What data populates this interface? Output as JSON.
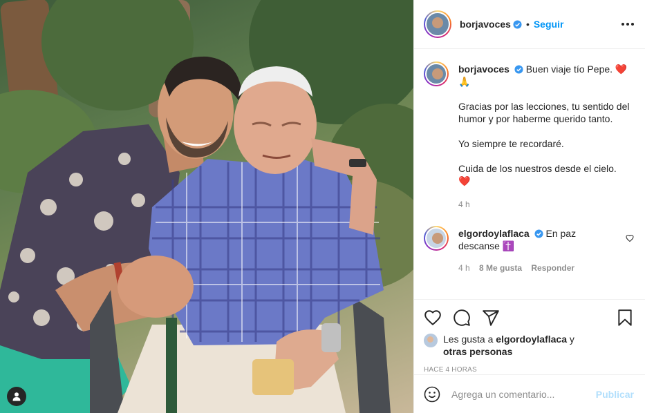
{
  "post": {
    "author": "borjavoces",
    "separator": "•",
    "follow_label": "Seguir",
    "photo_alt": "Borja Voces abrazando a su tío Pepe en un jardín"
  },
  "caption": {
    "author": "borjavoces",
    "line1": "Buen viaje tío Pepe.",
    "heart": "❤️",
    "pray": "🙏",
    "para2": "Gracias por las lecciones, tu sentido del humor y por haberme querido tanto.",
    "para3": "Yo siempre te recordaré.",
    "para4": "Cuida de los nuestros desde el cielo.",
    "heart2": "❤️",
    "time": "4 h"
  },
  "comment": {
    "author": "elgordoylaflaca",
    "text": "En paz descanse",
    "emoji": "✝️",
    "time": "4 h",
    "likes": "8 Me gusta",
    "reply_label": "Responder"
  },
  "likes": {
    "prefix": "Les gusta a",
    "user": "elgordoylaflaca",
    "connector": "y",
    "others": "otras personas"
  },
  "timestamp": "HACE 4 HORAS",
  "add_comment": {
    "placeholder": "Agrega un comentario...",
    "publish_label": "Publicar"
  },
  "colors": {
    "link_blue": "#0095f6",
    "publish_disabled": "#b2dffc",
    "muted": "#8e8e8e",
    "verified_blue": "#3897f0"
  },
  "icons": [
    "user-tag-icon",
    "verified-icon",
    "more-options-icon",
    "heart-icon",
    "comment-icon",
    "share-icon",
    "save-icon",
    "emoji-icon"
  ]
}
